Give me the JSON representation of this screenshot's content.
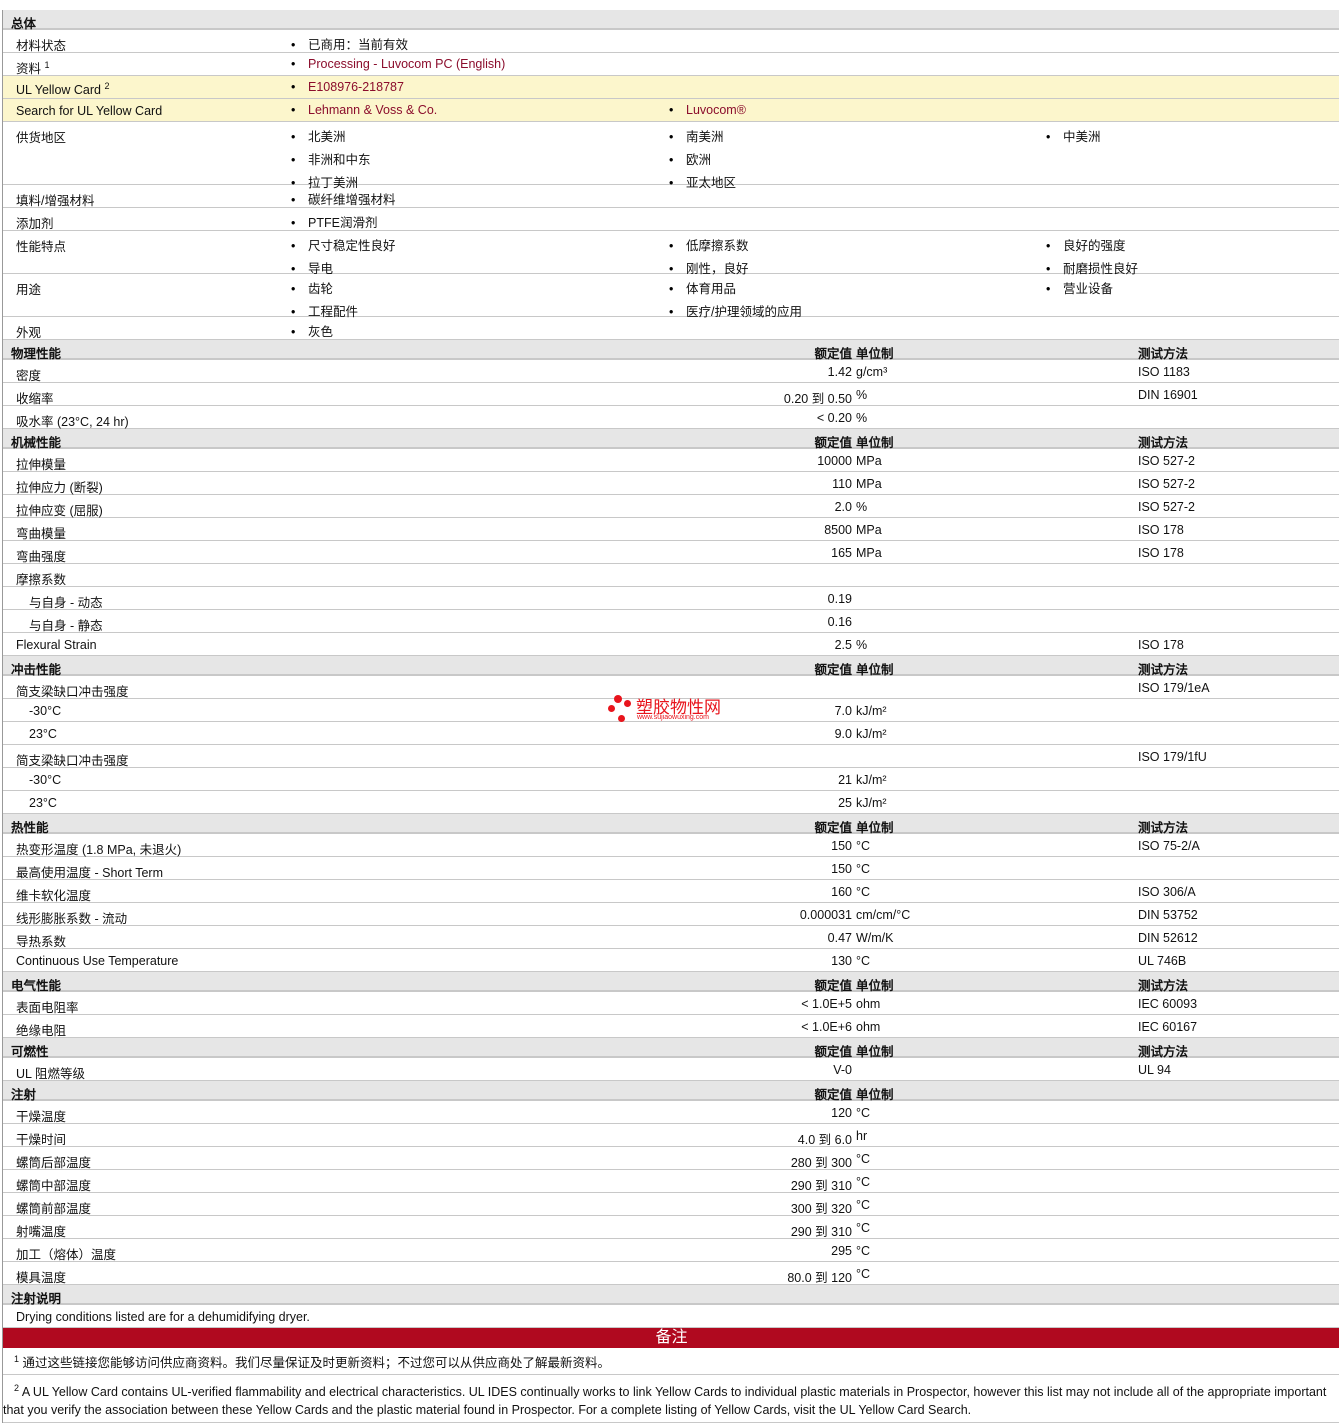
{
  "general": {
    "title": "总体",
    "rows": [
      {
        "label": "材料状态",
        "items": [
          "已商用：当前有效"
        ]
      },
      {
        "label": "资料",
        "sup": "1",
        "items": [
          "Processing - Luvocom PC (English)"
        ],
        "link": true
      },
      {
        "label": "UL Yellow Card",
        "sup": "2",
        "items": [
          "E108976-218787"
        ],
        "link": true,
        "yellow": true
      },
      {
        "label": "Search for UL Yellow Card",
        "items": [
          "Lehmann & Voss & Co.",
          "Luvocom®"
        ],
        "link": true,
        "yellow": true
      },
      {
        "label": "供货地区",
        "items": [
          "北美洲",
          "南美洲",
          "中美洲",
          "非洲和中东",
          "欧洲",
          "",
          "拉丁美洲",
          "亚太地区"
        ]
      },
      {
        "label": "填料/增强材料",
        "items": [
          "碳纤维增强材料"
        ]
      },
      {
        "label": "添加剂",
        "items": [
          "PTFE润滑剂"
        ]
      },
      {
        "label": "性能特点",
        "items": [
          "尺寸稳定性良好",
          "低摩擦系数",
          "良好的强度",
          "导电",
          "刚性，良好",
          "耐磨损性良好"
        ]
      },
      {
        "label": "用途",
        "items": [
          "齿轮",
          "体育用品",
          "营业设备",
          "工程配件",
          "医疗/护理领域的应用"
        ]
      },
      {
        "label": "外观",
        "items": [
          "灰色"
        ]
      }
    ]
  },
  "col_headers": {
    "value": "额定值",
    "unit": "单位制",
    "method": "测试方法"
  },
  "sections": [
    {
      "title": "物理性能",
      "method_header": true,
      "rows": [
        {
          "label": "密度",
          "value": "1.42",
          "unit": "g/cm³",
          "method": "ISO 1183"
        },
        {
          "label": "收缩率",
          "value": "0.20 到  0.50",
          "unit": "%",
          "method": "DIN 16901"
        },
        {
          "label": "吸水率  (23°C, 24 hr)",
          "value": "< 0.20",
          "unit": "%",
          "method": ""
        }
      ]
    },
    {
      "title": "机械性能",
      "method_header": true,
      "rows": [
        {
          "label": "拉伸模量",
          "value": "10000",
          "unit": "MPa",
          "method": "ISO 527-2"
        },
        {
          "label": "拉伸应力  (断裂)",
          "value": "110",
          "unit": "MPa",
          "method": "ISO 527-2"
        },
        {
          "label": "拉伸应变  (屈服)",
          "value": "2.0",
          "unit": "%",
          "method": "ISO 527-2"
        },
        {
          "label": "弯曲模量",
          "value": "8500",
          "unit": "MPa",
          "method": "ISO 178"
        },
        {
          "label": "弯曲强度",
          "value": "165",
          "unit": "MPa",
          "method": "ISO 178"
        },
        {
          "label": "摩擦系数",
          "value": "",
          "unit": "",
          "method": ""
        },
        {
          "label": "与自身  - 动态",
          "value": "0.19",
          "unit": "",
          "method": "",
          "indent": true
        },
        {
          "label": "与自身  - 静态",
          "value": "0.16",
          "unit": "",
          "method": "",
          "indent": true
        },
        {
          "label": "Flexural Strain",
          "value": "2.5",
          "unit": "%",
          "method": "ISO 178"
        }
      ]
    },
    {
      "title": "冲击性能",
      "method_header": true,
      "rows": [
        {
          "label": "简支梁缺口冲击强度",
          "value": "",
          "unit": "",
          "method": "ISO 179/1eA"
        },
        {
          "label": "-30°C",
          "value": "7.0",
          "unit": "kJ/m²",
          "method": "",
          "indent": true
        },
        {
          "label": "23°C",
          "value": "9.0",
          "unit": "kJ/m²",
          "method": "",
          "indent": true
        },
        {
          "label": "简支梁缺口冲击强度",
          "value": "",
          "unit": "",
          "method": "ISO 179/1fU"
        },
        {
          "label": "-30°C",
          "value": "21",
          "unit": "kJ/m²",
          "method": "",
          "indent": true
        },
        {
          "label": "23°C",
          "value": "25",
          "unit": "kJ/m²",
          "method": "",
          "indent": true
        }
      ]
    },
    {
      "title": "热性能",
      "method_header": true,
      "rows": [
        {
          "label": "热变形温度  (1.8 MPa, 未退火)",
          "value": "150",
          "unit": "°C",
          "method": "ISO 75-2/A"
        },
        {
          "label": "最高使用温度  - Short Term",
          "value": "150",
          "unit": "°C",
          "method": ""
        },
        {
          "label": "维卡软化温度",
          "value": "160",
          "unit": "°C",
          "method": "ISO 306/A"
        },
        {
          "label": "线形膨胀系数  - 流动",
          "value": "0.000031",
          "unit": "cm/cm/°C",
          "method": "DIN 53752"
        },
        {
          "label": "导热系数",
          "value": "0.47",
          "unit": "W/m/K",
          "method": "DIN 52612"
        },
        {
          "label": "Continuous Use Temperature",
          "value": "130",
          "unit": "°C",
          "method": "UL 746B"
        }
      ]
    },
    {
      "title": "电气性能",
      "method_header": true,
      "rows": [
        {
          "label": "表面电阻率",
          "value": "< 1.0E+5",
          "unit": "ohm",
          "method": "IEC 60093"
        },
        {
          "label": "绝缘电阻",
          "value": "< 1.0E+6",
          "unit": "ohm",
          "method": "IEC 60167"
        }
      ]
    },
    {
      "title": "可燃性",
      "method_header": true,
      "rows": [
        {
          "label": "UL 阻燃等级",
          "value": "V-0",
          "unit": "",
          "method": "UL 94"
        }
      ]
    },
    {
      "title": "注射",
      "method_header": false,
      "rows": [
        {
          "label": "干燥温度",
          "value": "120",
          "unit": "°C",
          "method": ""
        },
        {
          "label": "干燥时间",
          "value": "4.0 到  6.0",
          "unit": "hr",
          "method": ""
        },
        {
          "label": "螺筒后部温度",
          "value": "280 到  300",
          "unit": "°C",
          "method": ""
        },
        {
          "label": "螺筒中部温度",
          "value": "290 到  310",
          "unit": "°C",
          "method": ""
        },
        {
          "label": "螺筒前部温度",
          "value": "300 到  320",
          "unit": "°C",
          "method": ""
        },
        {
          "label": "射嘴温度",
          "value": "290 到  310",
          "unit": "°C",
          "method": ""
        },
        {
          "label": "加工（熔体）温度",
          "value": "295",
          "unit": "°C",
          "method": ""
        },
        {
          "label": "模具温度",
          "value": "80.0 到  120",
          "unit": "°C",
          "method": ""
        }
      ]
    }
  ],
  "injection_notes": {
    "title": "注射说明",
    "text": "Drying conditions listed are for a dehumidifying dryer."
  },
  "notes": {
    "title": "备注",
    "items": [
      {
        "sup": "1",
        "text": "通过这些链接您能够访问供应商资料。我们尽量保证及时更新资料；不过您可以从供应商处了解最新资料。"
      },
      {
        "sup": "2",
        "text": "A UL Yellow Card contains UL-verified flammability and electrical characteristics. UL IDES continually works to link Yellow Cards to individual plastic materials in Prospector, however this list may not include all of the appropriate important that you verify the association between these Yellow Cards and the plastic material found in Prospector. For a complete listing of Yellow Cards, visit the UL Yellow Card Search."
      }
    ]
  },
  "watermark": {
    "title": "塑胶物性网",
    "url": "www.sujiaowuxing.com"
  }
}
